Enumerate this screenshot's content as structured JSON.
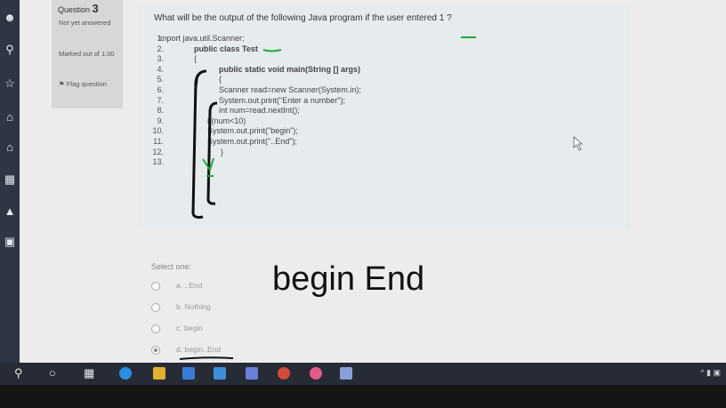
{
  "question": {
    "label": "Question",
    "number": "3",
    "status": "Not yet answered",
    "marks": "Marked out of 1.00",
    "flag": "Flag question",
    "text": "What will be the output of the following Java program if the user entered 1 ?"
  },
  "code_lines": [
    {
      "n": "1.",
      "text": "import java.util.Scanner;"
    },
    {
      "n": "2.",
      "text": "public class Test"
    },
    {
      "n": "3.",
      "text": "{"
    },
    {
      "n": "4.",
      "text": "public static void main(String [] args)"
    },
    {
      "n": "5.",
      "text": "{"
    },
    {
      "n": "6.",
      "text": "Scanner read=new Scanner(System.in);"
    },
    {
      "n": "7.",
      "text": "System.out.print(\"Enter a number\");"
    },
    {
      "n": "8.",
      "text": "int num=read.nextInt();"
    },
    {
      "n": "9.",
      "text": "if(num<10)"
    },
    {
      "n": "10.",
      "text": "System.out.print(\"begin\");"
    },
    {
      "n": "11.",
      "text": "System.out.print(\"..End\");"
    },
    {
      "n": "12.",
      "text": "}"
    },
    {
      "n": "13.",
      "text": "}"
    }
  ],
  "answers": {
    "prompt": "Select one:",
    "options": [
      {
        "letter": "a.",
        "text": "..End",
        "selected": false
      },
      {
        "letter": "b.",
        "text": "Nothing",
        "selected": false
      },
      {
        "letter": "c.",
        "text": "begin",
        "selected": false
      },
      {
        "letter": "d.",
        "text": "begin..End",
        "selected": true
      }
    ]
  },
  "handwritten_answer": "begin End",
  "colors": {
    "rail": "#2e3644",
    "panel": "#e6ebee",
    "ink_green": "#1fa83a",
    "ink_black": "#111111"
  }
}
